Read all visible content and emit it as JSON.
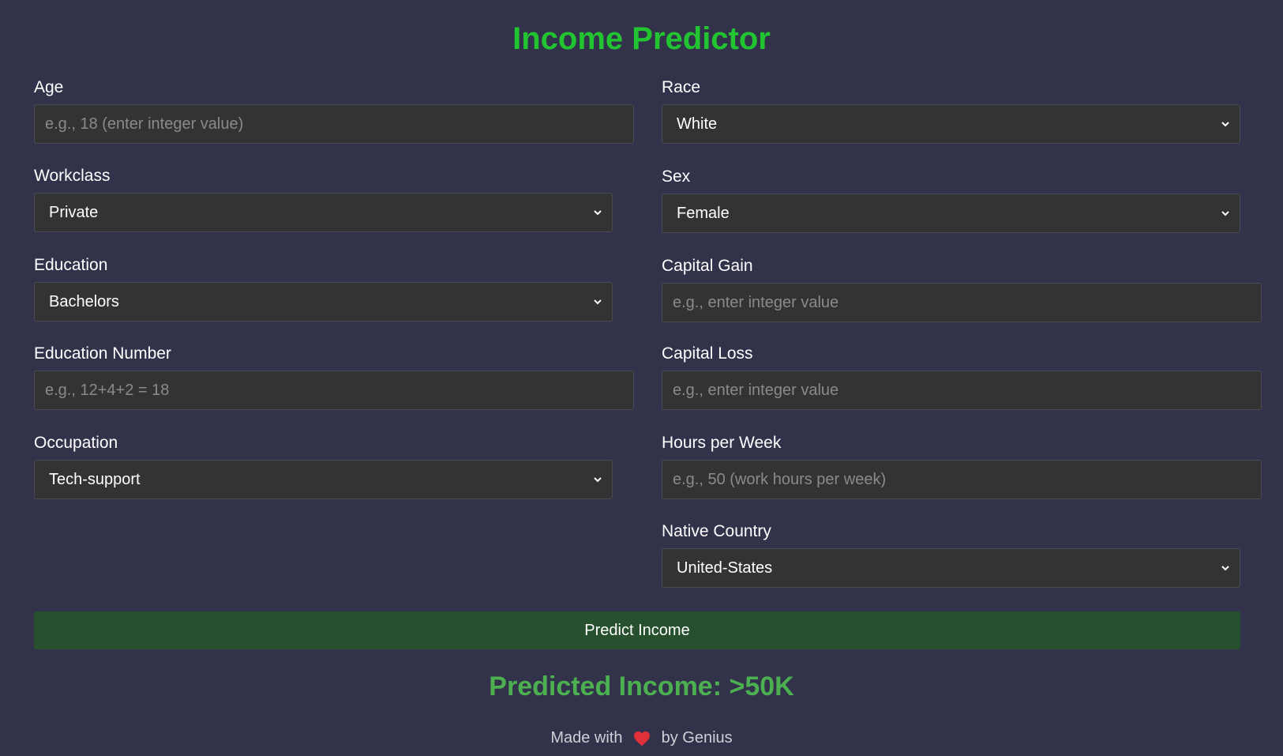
{
  "app": {
    "title": "Income Predictor"
  },
  "form": {
    "age": {
      "label": "Age",
      "value": "",
      "placeholder": "e.g., 18 (enter integer value)"
    },
    "workclass": {
      "label": "Workclass",
      "selected": "Private"
    },
    "education": {
      "label": "Education",
      "selected": "Bachelors"
    },
    "education_number": {
      "label": "Education Number",
      "value": "",
      "placeholder": "e.g., 12+4+2 = 18"
    },
    "occupation": {
      "label": "Occupation",
      "selected": "Tech-support"
    },
    "race": {
      "label": "Race",
      "selected": "White"
    },
    "sex": {
      "label": "Sex",
      "selected": "Female"
    },
    "capital_gain": {
      "label": "Capital Gain",
      "value": "",
      "placeholder": "e.g., enter integer value"
    },
    "capital_loss": {
      "label": "Capital Loss",
      "value": "",
      "placeholder": "e.g., enter integer value"
    },
    "hours_per_week": {
      "label": "Hours per Week",
      "value": "",
      "placeholder": "e.g., 50 (work hours per week)"
    },
    "native_country": {
      "label": "Native Country",
      "selected": "United-States"
    }
  },
  "predict_button": {
    "label": "Predict Income"
  },
  "result": {
    "text": "Predicted Income: >50K"
  },
  "footer": {
    "before": "Made with",
    "after": "by Genius",
    "icon": "heart-icon"
  },
  "colors": {
    "background": "#32334b",
    "title": "#22c431",
    "button": "#27502e",
    "result": "#4caf50",
    "heart": "#e0303a"
  }
}
